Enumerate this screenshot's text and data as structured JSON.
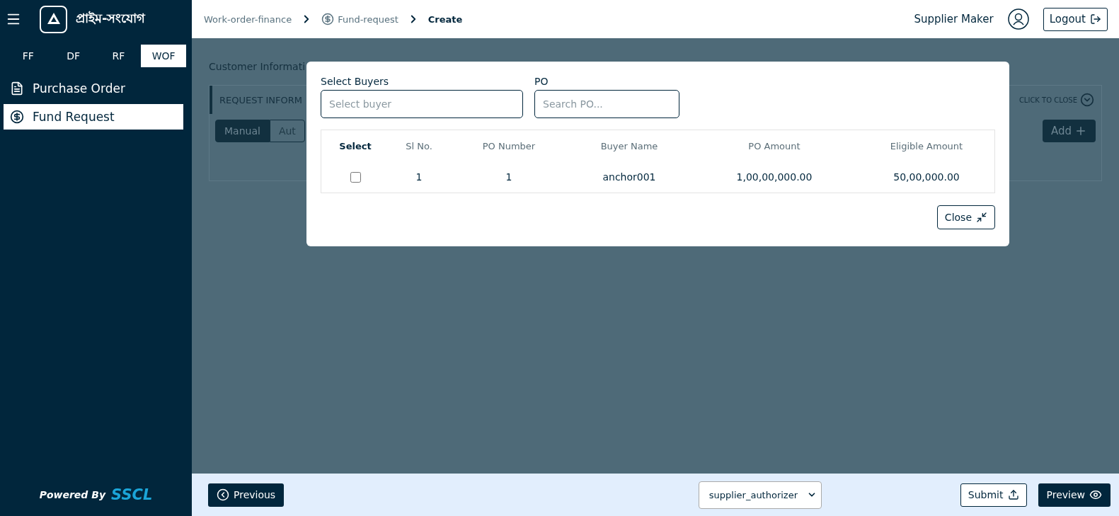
{
  "sidebar": {
    "logo": "প্রাইম-সংযোগ",
    "tabs": [
      {
        "label": "FF",
        "selected": false
      },
      {
        "label": "DF",
        "selected": false
      },
      {
        "label": "RF",
        "selected": false
      },
      {
        "label": "WOF",
        "selected": true
      }
    ],
    "items": [
      {
        "label": "Purchase Order",
        "kind": "list",
        "selected": false
      },
      {
        "label": "Fund Request",
        "kind": "dollar",
        "selected": true
      }
    ],
    "powered_by": "Powered By",
    "brand": "SSCL"
  },
  "breadcrumb": [
    {
      "label": "Work-order-finance",
      "kind": "plain",
      "current": false
    },
    {
      "label": "Fund-request",
      "kind": "dollar",
      "current": false
    },
    {
      "label": "Create",
      "kind": "plain",
      "current": true
    }
  ],
  "user": {
    "name": "Supplier Maker",
    "logout": "Logout"
  },
  "background": {
    "section_title": "Customer Informati",
    "panel_title": "REQUEST INFORM",
    "collapse": "CLICK TO CLOSE",
    "modes": [
      {
        "label": "Manual",
        "selected": true
      },
      {
        "label": "Aut",
        "selected": false
      }
    ],
    "add": "Add"
  },
  "modal": {
    "buyers_label": "Select Buyers",
    "buyers_placeholder": "Select buyer",
    "po_label": "PO",
    "po_placeholder": "Search PO...",
    "columns": [
      "Select",
      "Sl No.",
      "PO Number",
      "Buyer Name",
      "PO Amount",
      "Eligible Amount"
    ],
    "rows": [
      {
        "checked": false,
        "cells": [
          "",
          "1",
          "1",
          "anchor001",
          "1,00,00,000.00",
          "50,00,000.00"
        ]
      }
    ],
    "close": "Close"
  },
  "footer": {
    "previous": "Previous",
    "role": "supplier_authorizer",
    "submit": "Submit",
    "preview": "Preview"
  }
}
